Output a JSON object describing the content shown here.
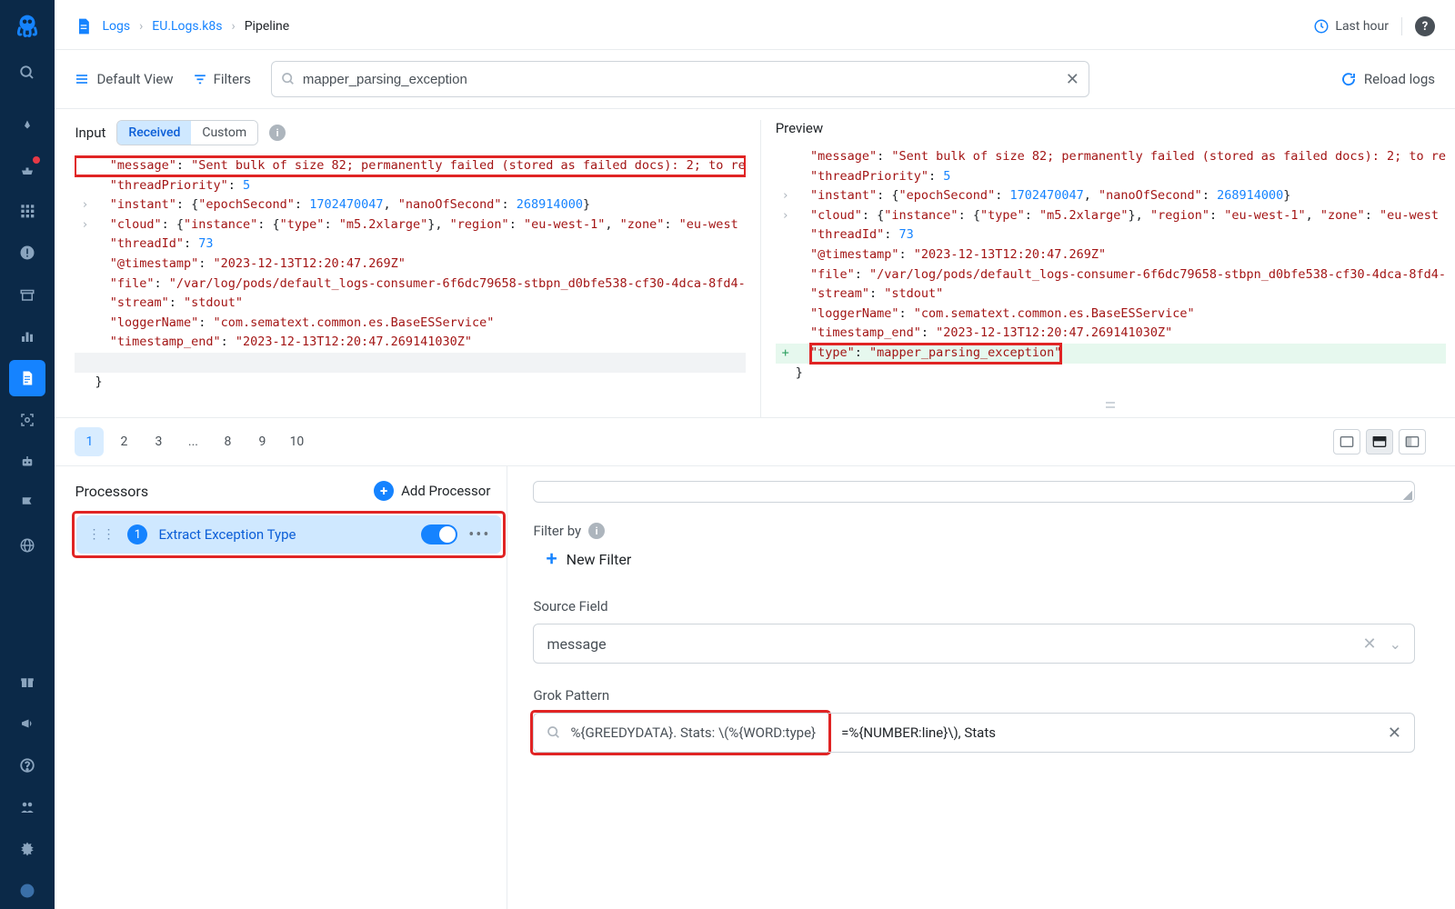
{
  "breadcrumb": {
    "root": "Logs",
    "app": "EU.Logs.k8s",
    "page": "Pipeline"
  },
  "topbar": {
    "time_range": "Last hour"
  },
  "toolbar": {
    "default_view": "Default View",
    "filters": "Filters",
    "search_value": "mapper_parsing_exception",
    "reload": "Reload logs"
  },
  "input": {
    "title": "Input",
    "tab_received": "Received",
    "tab_custom": "Custom"
  },
  "preview": {
    "title": "Preview"
  },
  "log": {
    "message_key": "\"message\"",
    "message_val": "\"Sent bulk of size 82; permanently failed (stored as failed docs): 2; to re",
    "threadPriority_key": "\"threadPriority\"",
    "threadPriority_val": "5",
    "instant_key": "\"instant\"",
    "epochSecond_key": "\"epochSecond\"",
    "epochSecond_val": "1702470047",
    "nanoOfSecond_key": "\"nanoOfSecond\"",
    "nanoOfSecond_val": "268914000",
    "cloud_key": "\"cloud\"",
    "instance_key": "\"instance\"",
    "type_key": "\"type\"",
    "type_val": "\"m5.2xlarge\"",
    "region_key": "\"region\"",
    "region_val": "\"eu-west-1\"",
    "zone_key": "\"zone\"",
    "zone_val": "\"eu-west",
    "threadId_key": "\"threadId\"",
    "threadId_val": "73",
    "timestamp_key": "\"@timestamp\"",
    "timestamp_val": "\"2023-12-13T12:20:47.269Z\"",
    "file_key": "\"file\"",
    "file_val": "\"/var/log/pods/default_logs-consumer-6f6dc79658-stbpn_d0bfe538-cf30-4dca-8fd4-",
    "stream_key": "\"stream\"",
    "stream_val": "\"stdout\"",
    "loggerName_key": "\"loggerName\"",
    "loggerName_val": "\"com.sematext.common.es.BaseESService\"",
    "timestamp_end_key": "\"timestamp_end\"",
    "timestamp_end_val": "\"2023-12-13T12:20:47.269141030Z\"",
    "new_type_key": "\"type\"",
    "new_type_val": "\"mapper_parsing_exception\"",
    "close_brace": "}"
  },
  "pager": {
    "p1": "1",
    "p2": "2",
    "p3": "3",
    "dots": "...",
    "p8": "8",
    "p9": "9",
    "p10": "10"
  },
  "processors": {
    "title": "Processors",
    "add": "Add Processor",
    "item_num": "1",
    "item_name": "Extract Exception Type"
  },
  "config": {
    "filter_by": "Filter by",
    "new_filter": "New Filter",
    "source_field_label": "Source Field",
    "source_field_value": "message",
    "grok_label": "Grok Pattern",
    "grok_value_a": "%{GREEDYDATA}. Stats: \\(%{WORD:type}",
    "grok_value_b": "=%{NUMBER:line}\\), Stats"
  }
}
